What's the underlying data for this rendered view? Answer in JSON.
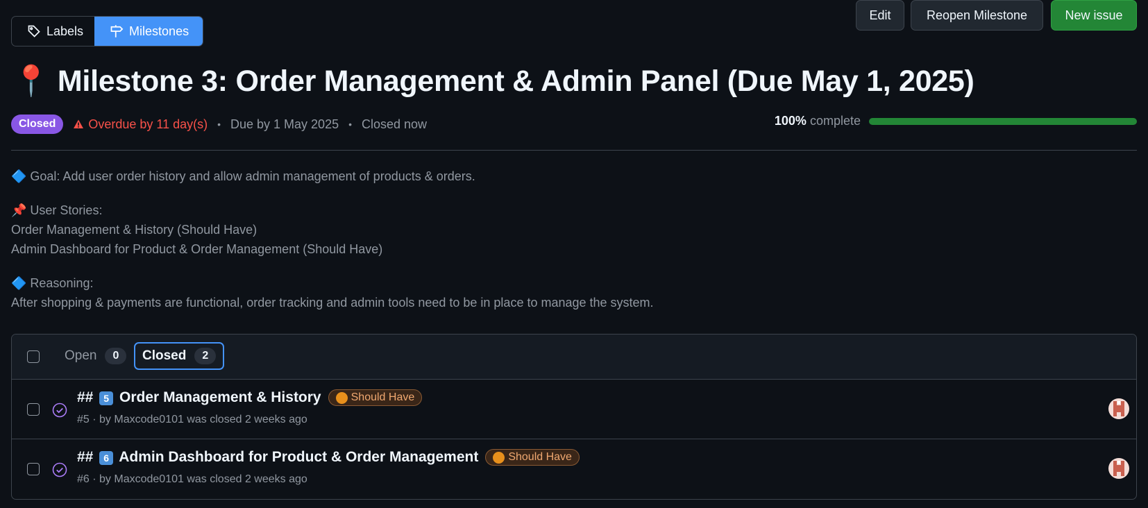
{
  "nav": {
    "labels_label": "Labels",
    "milestones_label": "Milestones"
  },
  "actions": {
    "edit_label": "Edit",
    "reopen_label": "Reopen Milestone",
    "new_issue_label": "New issue"
  },
  "milestone": {
    "pin_emoji": "📍",
    "title": "Milestone 3: Order Management & Admin Panel (Due May 1, 2025)",
    "state_badge": "Closed",
    "overdue_text": "Overdue by 11 day(s)",
    "due_text": "Due by 1 May 2025",
    "closed_text": "Closed now",
    "progress_percent": "100%",
    "progress_suffix": "complete",
    "progress_value": 100
  },
  "description": {
    "goal": "🔷 Goal: Add user order history and allow admin management of products & orders.",
    "stories_heading": "📌 User Stories:",
    "story_1": "Order Management & History (Should Have)",
    "story_2": "Admin Dashboard for Product & Order Management (Should Have)",
    "reasoning_heading": "🔷 Reasoning:",
    "reasoning_text": "After shopping & payments are functional, order tracking and admin tools need to be in place to manage the system."
  },
  "issues_tabs": {
    "open_label": "Open",
    "open_count": "0",
    "closed_label": "Closed",
    "closed_count": "2"
  },
  "issues": [
    {
      "prefix": "##",
      "number_key": "5",
      "title": "Order Management & History",
      "label": "Should Have",
      "number": "#5",
      "by_text": "· by",
      "author": "Maxcode0101",
      "closed_text": "was closed 2 weeks ago"
    },
    {
      "prefix": "##",
      "number_key": "6",
      "title": "Admin Dashboard for Product & Order Management",
      "label": "Should Have",
      "number": "#6",
      "by_text": "· by",
      "author": "Maxcode0101",
      "closed_text": "was closed 2 weeks ago"
    }
  ],
  "colors": {
    "accent": "#4493f8",
    "closed_purple": "#8957e5",
    "success_green": "#238636",
    "danger_red": "#f85149"
  }
}
